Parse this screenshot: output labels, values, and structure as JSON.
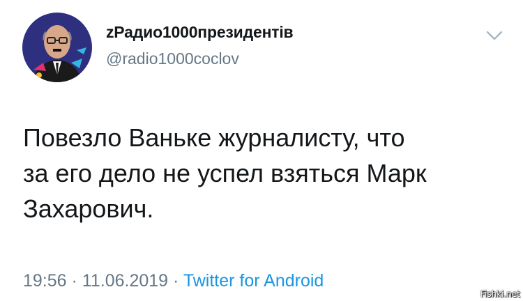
{
  "tweet": {
    "display_name": "zРадио1000президентів",
    "handle": "@radio1000coclov",
    "text_lines": [
      "Повезло Ваньке журналисту, что",
      "за его дело не успел взяться Марк",
      "Захарович."
    ],
    "time": "19:56",
    "separator": "·",
    "date": "11.06.2019",
    "source": "Twitter for Android"
  },
  "watermark": "Fishki.net",
  "icons": {
    "avatar": "avatar-image",
    "chevron": "chevron-down-icon"
  },
  "colors": {
    "text": "#14171a",
    "secondary": "#657786",
    "link": "#1b95e0",
    "avatar_bg": "#2e2f7e"
  }
}
